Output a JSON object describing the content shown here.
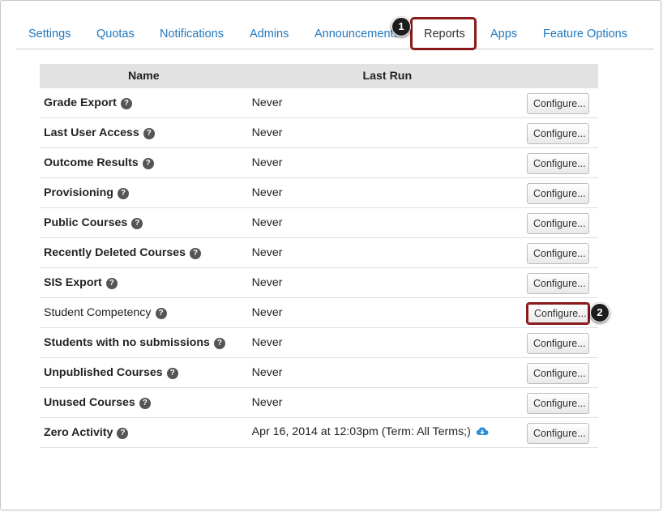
{
  "tabs": [
    {
      "label": "Settings"
    },
    {
      "label": "Quotas"
    },
    {
      "label": "Notifications"
    },
    {
      "label": "Admins"
    },
    {
      "label": "Announcements"
    },
    {
      "label": "Reports"
    },
    {
      "label": "Apps"
    },
    {
      "label": "Feature Options"
    }
  ],
  "active_tab": "Reports",
  "callouts": {
    "one": "1",
    "two": "2"
  },
  "table": {
    "headers": {
      "name": "Name",
      "last_run": "Last Run"
    },
    "rows": [
      {
        "name": "Grade Export",
        "last_run": "Never",
        "action": "Configure..."
      },
      {
        "name": "Last User Access",
        "last_run": "Never",
        "action": "Configure..."
      },
      {
        "name": "Outcome Results",
        "last_run": "Never",
        "action": "Configure..."
      },
      {
        "name": "Provisioning",
        "last_run": "Never",
        "action": "Configure..."
      },
      {
        "name": "Public Courses",
        "last_run": "Never",
        "action": "Configure..."
      },
      {
        "name": "Recently Deleted Courses",
        "last_run": "Never",
        "action": "Configure..."
      },
      {
        "name": "SIS Export",
        "last_run": "Never",
        "action": "Configure..."
      },
      {
        "name": "Student Competency",
        "last_run": "Never",
        "action": "Configure..."
      },
      {
        "name": "Students with no submissions",
        "last_run": "Never",
        "action": "Configure..."
      },
      {
        "name": "Unpublished Courses",
        "last_run": "Never",
        "action": "Configure..."
      },
      {
        "name": "Unused Courses",
        "last_run": "Never",
        "action": "Configure..."
      },
      {
        "name": "Zero Activity",
        "last_run": "Apr 16, 2014 at 12:03pm (Term: All Terms;)",
        "action": "Configure..."
      }
    ]
  },
  "help_glyph": "?",
  "colors": {
    "link": "#2277bb",
    "callout_border": "#8b1a1a",
    "header_bg": "#e2e2e2"
  },
  "icons": {
    "download": "cloud-download-icon",
    "help": "help-icon"
  }
}
